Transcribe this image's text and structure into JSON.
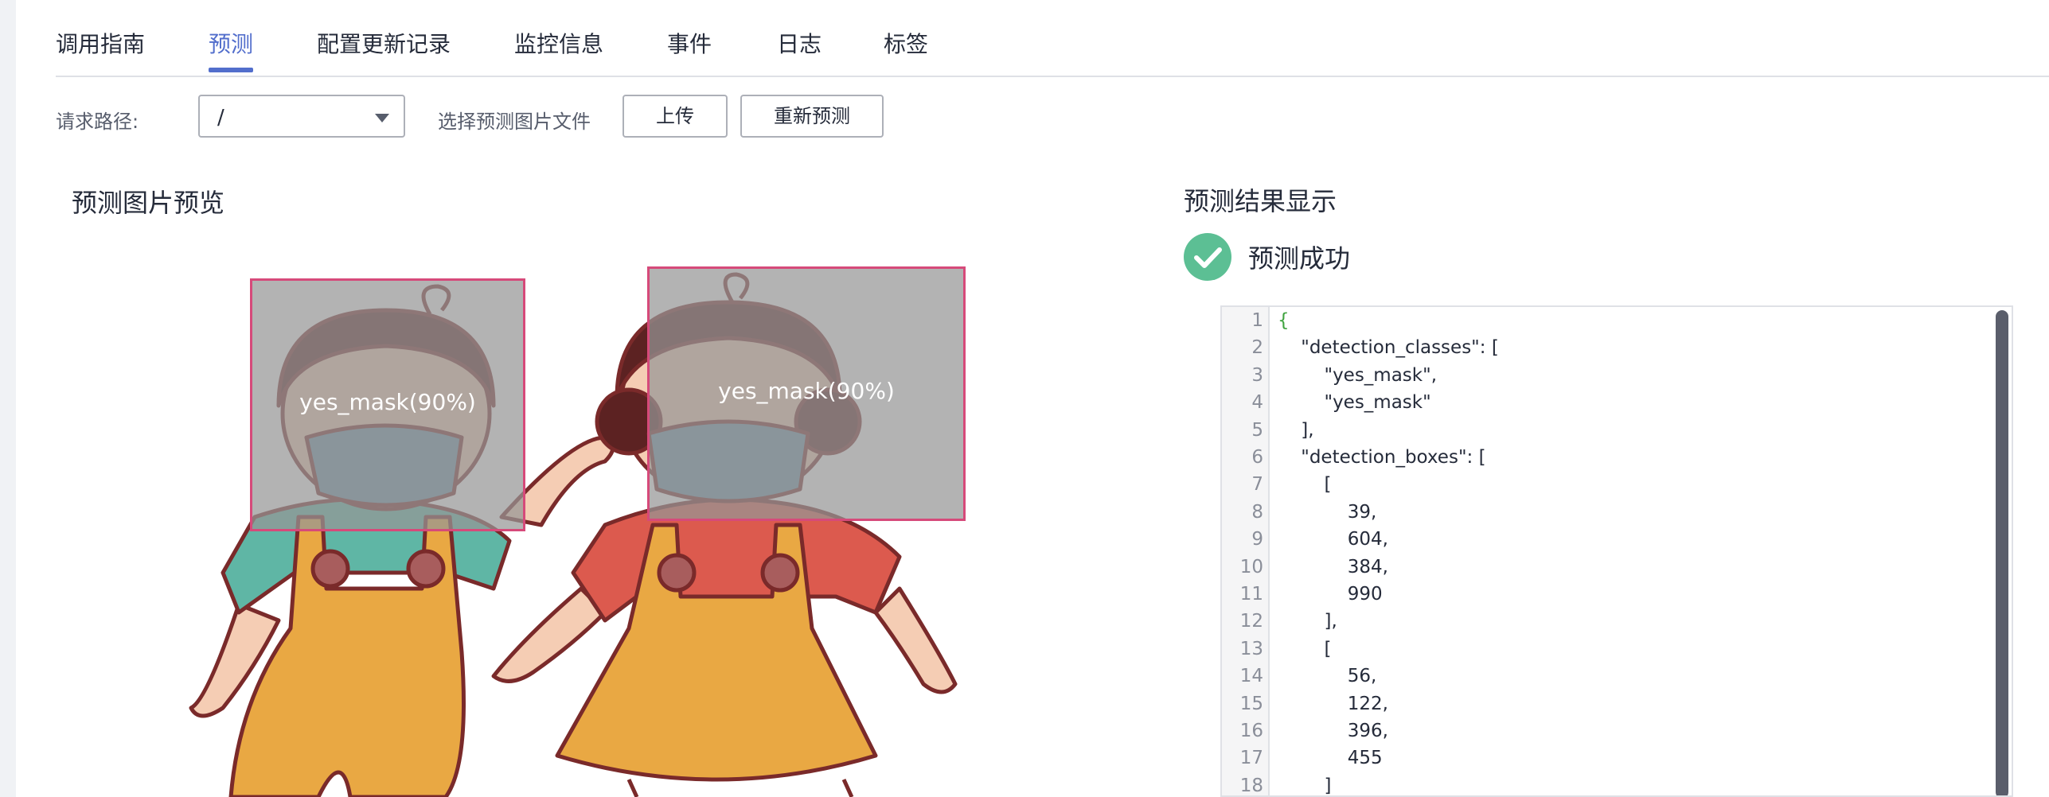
{
  "tabs": [
    {
      "label": "调用指南",
      "active": false
    },
    {
      "label": "预测",
      "active": true
    },
    {
      "label": "配置更新记录",
      "active": false
    },
    {
      "label": "监控信息",
      "active": false
    },
    {
      "label": "事件",
      "active": false
    },
    {
      "label": "日志",
      "active": false
    },
    {
      "label": "标签",
      "active": false
    }
  ],
  "toolbar": {
    "path_label": "请求路径:",
    "path_value": "/",
    "select_file_label": "选择预测图片文件",
    "upload_button": "上传",
    "repredict_button": "重新预测"
  },
  "preview": {
    "title": "预测图片预览",
    "detections": [
      {
        "label": "yes_mask(90%)"
      },
      {
        "label": "yes_mask(90%)"
      }
    ]
  },
  "result": {
    "title": "预测结果显示",
    "status": "预测成功",
    "status_color": "#5cbf94",
    "code_lines": [
      "{",
      "    \"detection_classes\": [",
      "        \"yes_mask\",",
      "        \"yes_mask\"",
      "    ],",
      "    \"detection_boxes\": [",
      "        [",
      "            39,",
      "            604,",
      "            384,",
      "            990",
      "        ],",
      "        [",
      "            56,",
      "            122,",
      "            396,",
      "            455",
      "        ]"
    ]
  },
  "colors": {
    "accent": "#526ecc",
    "box_border": "#d64a7a"
  }
}
